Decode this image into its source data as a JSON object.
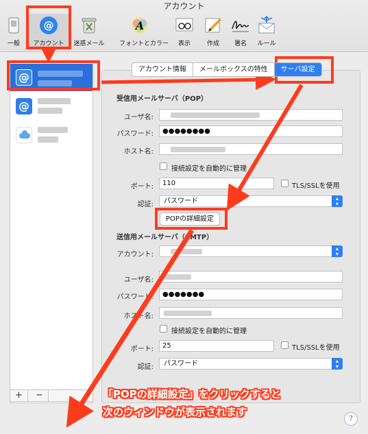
{
  "window": {
    "title": "アカウント"
  },
  "toolbar": {
    "items": [
      {
        "label": "一般"
      },
      {
        "label": "アカウント"
      },
      {
        "label": "迷惑メール"
      },
      {
        "label": "フォントとカラー"
      },
      {
        "label": "表示"
      },
      {
        "label": "作成"
      },
      {
        "label": "署名"
      },
      {
        "label": "ルール"
      }
    ]
  },
  "sidebar": {
    "add_label": "+",
    "remove_label": "−"
  },
  "tabs": [
    {
      "label": "アカウント情報"
    },
    {
      "label": "メールボックスの特性"
    },
    {
      "label": "サーバ設定"
    }
  ],
  "incoming": {
    "heading": "受信用メールサーバ（POP）",
    "username_label": "ユーザ名:",
    "password_label": "パスワード:",
    "password_value": "●●●●●●●●",
    "host_label": "ホスト名:",
    "auto_manage_label": "接続設定を自動的に管理",
    "port_label": "ポート:",
    "port_value": "110",
    "tls_label": "TLS/SSLを使用",
    "auth_label": "認証:",
    "auth_value": "パスワード",
    "advanced_button": "POPの詳細設定"
  },
  "outgoing": {
    "heading": "送信用メールサーバ（SMTP）",
    "account_label": "アカウント:",
    "username_label": "ユーザ名:",
    "password_label": "パスワード:",
    "password_value": "●●●●●●●",
    "host_label": "ホスト名:",
    "auto_manage_label": "接続設定を自動的に管理",
    "port_label": "ポート:",
    "port_value": "25",
    "tls_label": "TLS/SSLを使用",
    "auth_label": "認証:",
    "auth_value": "パスワード"
  },
  "annotation": {
    "line1": "「POPの詳細設定」をクリックすると",
    "line2": "次のウィンドウが表示されます"
  },
  "help_label": "?",
  "colors": {
    "accent": "#2f7ff0",
    "annotation": "#ff3b1d"
  }
}
